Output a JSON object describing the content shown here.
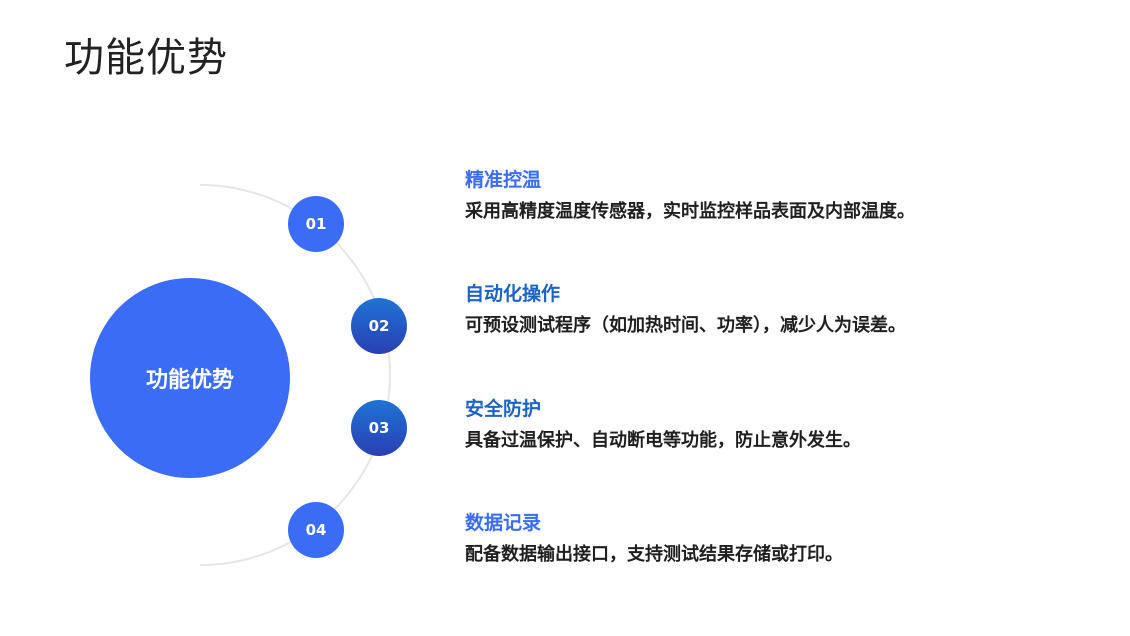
{
  "page": {
    "title": "功能优势"
  },
  "colors": {
    "primary_blue": "#3b6cf6",
    "dark_blue": "#2442b5",
    "title_blue_1": "#3a6cf4",
    "title_blue_2": "#1c63c4",
    "arc_gray": "#e6e6e6",
    "text_dark": "#1f1f1f"
  },
  "center": {
    "label": "功能优势"
  },
  "features": [
    {
      "number": "01",
      "title": "精准控温",
      "description": "采用高精度温度传感器，实时监控样品表面及内部温度。"
    },
    {
      "number": "02",
      "title": "自动化操作",
      "description": "可预设测试程序（如加热时间、功率），减少人为误差。"
    },
    {
      "number": "03",
      "title": "安全防护",
      "description": "具备过温保护、自动断电等功能，防止意外发生。"
    },
    {
      "number": "04",
      "title": "数据记录",
      "description": "配备数据输出接口，支持测试结果存储或打印。"
    }
  ]
}
